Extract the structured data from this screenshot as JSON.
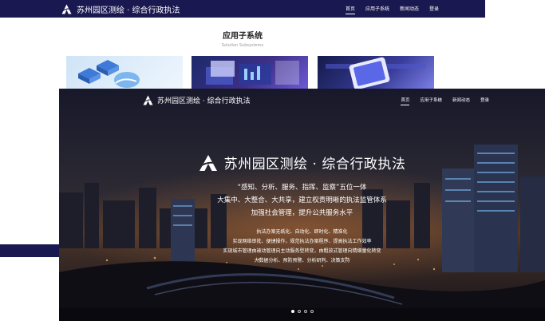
{
  "site_title": "苏州园区测绘 · 综合行政执法",
  "nav": {
    "items": [
      "首页",
      "应用子系统",
      "新闻动态",
      "登录"
    ],
    "active_index": 0
  },
  "section": {
    "title": "应用子系统",
    "subtitle": "Solution Subsystems"
  },
  "hero": {
    "title": "苏州园区测绘 · 综合行政执法",
    "lines": [
      "“感知、分析、服务、指挥、监察”五位一体",
      "大集中、大整合、大共享，建立权责明晰的执法监管体系",
      "加强社会管理，提升公共服务水平"
    ],
    "small_lines": [
      "执法办案无纸化、自动化、即时化、精准化",
      "实现网络审批、便捷操作，规范执法办案程序、提高执法工作效率",
      "实现城市管理由被动管理向主动服务型转变，由粗放式管理向精细量化转变",
      "大数据分析、预防预警、分析研判、决策支持"
    ]
  },
  "carousel": {
    "slides": 4,
    "active_index": 0
  },
  "colors": {
    "nav_bg": "#1a1850",
    "text": "#ffffff"
  },
  "icons": [
    "logo-icon"
  ]
}
